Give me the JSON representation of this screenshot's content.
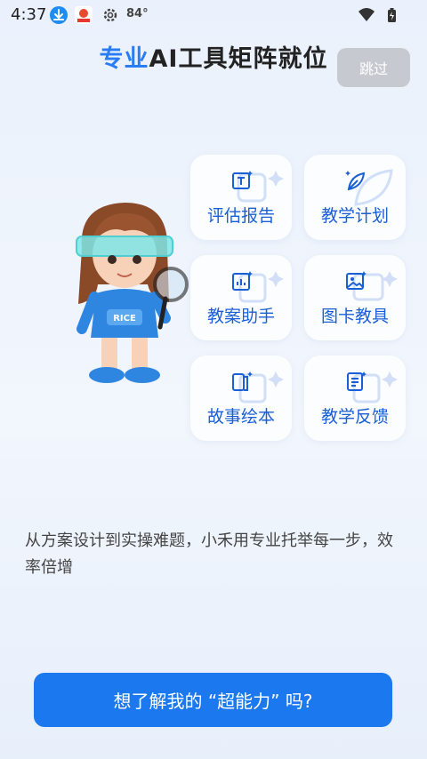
{
  "status_bar": {
    "time": "4:37",
    "temperature": "84°"
  },
  "header": {
    "title_highlight": "专业",
    "title_rest": "AI工具矩阵就位",
    "skip_label": "跳过"
  },
  "mascot": {
    "badge_text": "RICE"
  },
  "features": [
    {
      "label": "评估报告",
      "icon": "text-edit-icon"
    },
    {
      "label": "教学计划",
      "icon": "leaf-icon"
    },
    {
      "label": "教案助手",
      "icon": "chart-doc-icon"
    },
    {
      "label": "图卡教具",
      "icon": "image-icon"
    },
    {
      "label": "故事绘本",
      "icon": "book-icon"
    },
    {
      "label": "教学反馈",
      "icon": "feedback-doc-icon"
    }
  ],
  "description": "从方案设计到实操难题，小禾用专业托举每一步，效率倍增",
  "cta": {
    "label": "想了解我的 “超能力” 吗?"
  },
  "colors": {
    "accent": "#2a7cf4",
    "button": "#1b78ee",
    "card_text": "#1a5fd6",
    "skip_bg": "#c6cad0"
  }
}
